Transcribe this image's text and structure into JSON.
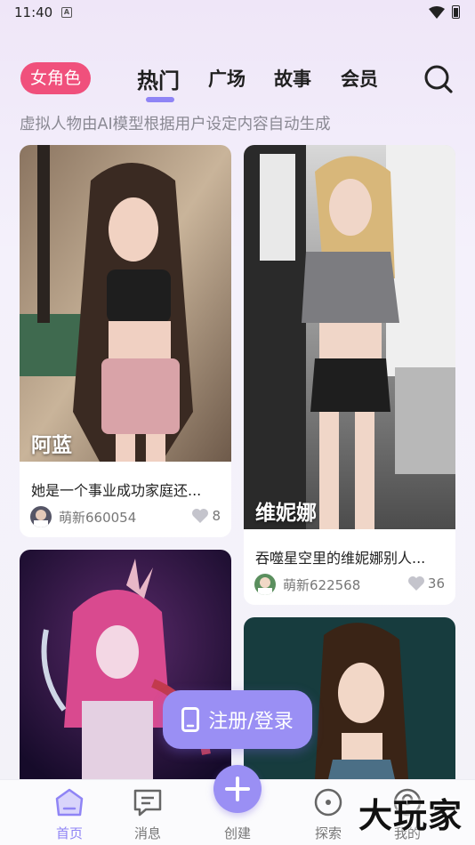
{
  "status": {
    "time": "11:40",
    "notification_icon": "A"
  },
  "header": {
    "role_pill": "女角色",
    "tabs": [
      {
        "label": "热门",
        "active": true
      },
      {
        "label": "广场",
        "active": false
      },
      {
        "label": "故事",
        "active": false
      },
      {
        "label": "会员",
        "active": false
      }
    ]
  },
  "subtitle": "虚拟人物由AI模型根据用户设定内容自动生成",
  "cards": [
    {
      "name": "阿蓝",
      "desc": "她是一个事业成功家庭还...",
      "user": "萌新660054",
      "likes": "8"
    },
    {
      "name": "维妮娜",
      "desc": "吞噬星空里的维妮娜别人...",
      "user": "萌新622568",
      "likes": "36"
    },
    {
      "name": "",
      "desc": "",
      "user": "",
      "likes": ""
    },
    {
      "name": "",
      "desc": "",
      "user": "",
      "likes": ""
    }
  ],
  "login_button": "注册/登录",
  "bottom_nav": [
    {
      "label": "首页",
      "icon": "home-icon",
      "active": true
    },
    {
      "label": "消息",
      "icon": "message-icon",
      "active": false
    },
    {
      "label": "创建",
      "icon": "plus-icon",
      "active": false
    },
    {
      "label": "探索",
      "icon": "explore-icon",
      "active": false
    },
    {
      "label": "我的",
      "icon": "profile-icon",
      "active": false
    }
  ],
  "watermark": "大玩家",
  "colors": {
    "accent": "#9a8ff4",
    "pill": "#f0507c"
  }
}
